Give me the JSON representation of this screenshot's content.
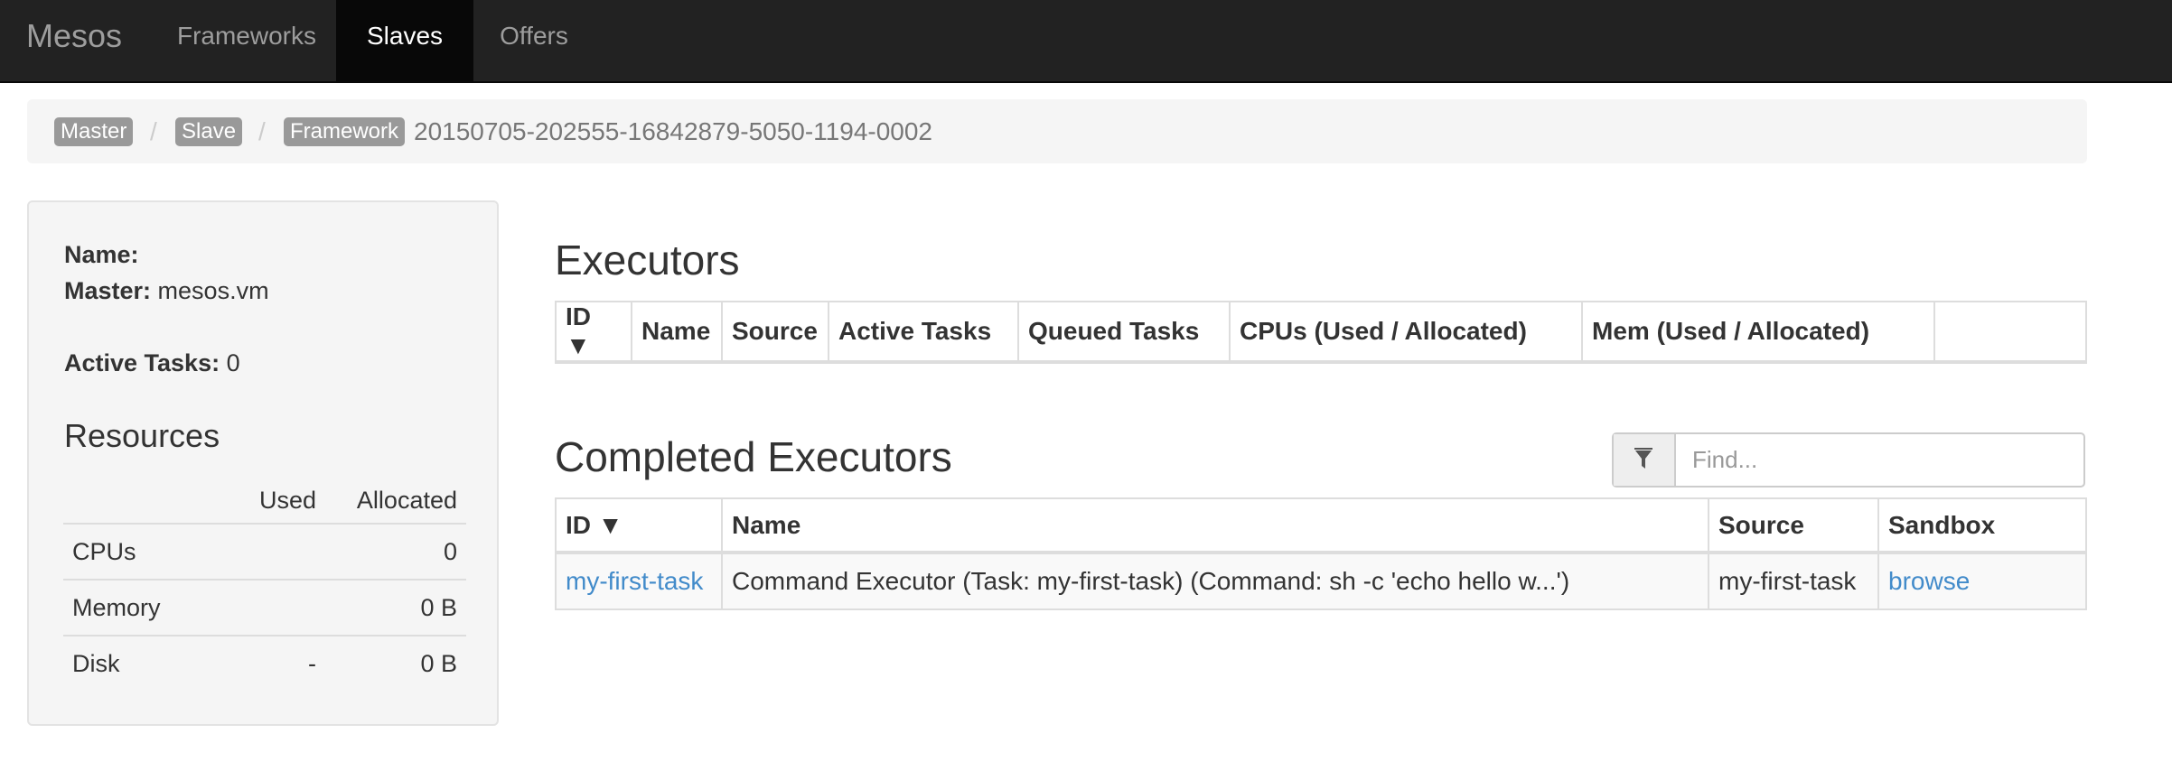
{
  "nav": {
    "brand": "Mesos",
    "items": [
      {
        "label": "Frameworks",
        "active": false
      },
      {
        "label": "Slaves",
        "active": true
      },
      {
        "label": "Offers",
        "active": false
      }
    ]
  },
  "breadcrumb": {
    "items": [
      "Master",
      "Slave",
      "Framework"
    ],
    "separator": "/",
    "current": "20150705-202555-16842879-5050-1194-0002"
  },
  "sidebar": {
    "name_label": "Name:",
    "name_value": "",
    "master_label": "Master:",
    "master_value": "mesos.vm",
    "active_tasks_label": "Active Tasks:",
    "active_tasks_value": "0",
    "resources_title": "Resources",
    "resources_headers": [
      "",
      "Used",
      "Allocated"
    ],
    "resources_rows": [
      {
        "name": "CPUs",
        "used": "",
        "allocated": "0"
      },
      {
        "name": "Memory",
        "used": "",
        "allocated": "0 B"
      },
      {
        "name": "Disk",
        "used": "-",
        "allocated": "0 B"
      }
    ]
  },
  "executors": {
    "title": "Executors",
    "headers": [
      "ID ▼",
      "Name",
      "Source",
      "Active Tasks",
      "Queued Tasks",
      "CPUs (Used / Allocated)",
      "Mem (Used / Allocated)"
    ]
  },
  "completed_executors": {
    "title": "Completed Executors",
    "filter_placeholder": "Find...",
    "filter_icon": "filter-icon",
    "headers": [
      "ID ▼",
      "Name",
      "Source",
      "Sandbox"
    ],
    "rows": [
      {
        "id": "my-first-task",
        "name": "Command Executor (Task: my-first-task) (Command: sh -c 'echo hello w...')",
        "source": "my-first-task",
        "sandbox": "browse"
      }
    ]
  },
  "colors": {
    "navbar": "#222222",
    "link": "#428bca",
    "label": "#999999"
  }
}
